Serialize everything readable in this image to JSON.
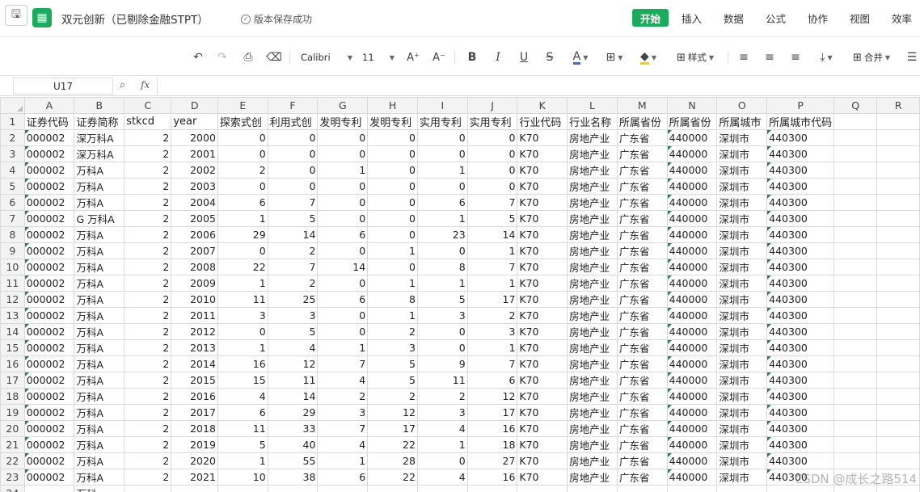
{
  "titlebar": {
    "doc_title": "双元创新（已剔除金融STPT）",
    "save_status": "版本保存成功",
    "menus": [
      "开始",
      "插入",
      "数据",
      "公式",
      "协作",
      "视图",
      "效率"
    ]
  },
  "toolbar": {
    "font_name": "Calibri",
    "font_size": "11",
    "style_label": "样式",
    "merge_label": "合并"
  },
  "formula_bar": {
    "cell_ref": "U17",
    "fx": "fx",
    "value": ""
  },
  "grid": {
    "columns": [
      "A",
      "B",
      "C",
      "D",
      "E",
      "F",
      "G",
      "H",
      "I",
      "J",
      "K",
      "L",
      "M",
      "N",
      "O",
      "P",
      "Q",
      "R"
    ],
    "header_row": [
      "证券代码",
      "证券简称",
      "stkcd",
      "year",
      "探索式创",
      "利用式创",
      "发明专利",
      "发明专利",
      "实用专利",
      "实用专利",
      "行业代码",
      "行业名称",
      "所属省份",
      "所属省份",
      "所属城市",
      "所属城市代码",
      "",
      ""
    ],
    "rows": [
      [
        "000002",
        "深万科A",
        "2",
        "2000",
        "0",
        "0",
        "0",
        "0",
        "0",
        "0",
        "K70",
        "房地产业",
        "广东省",
        "440000",
        "深圳市",
        "440300"
      ],
      [
        "000002",
        "深万科A",
        "2",
        "2001",
        "0",
        "0",
        "0",
        "0",
        "0",
        "0",
        "K70",
        "房地产业",
        "广东省",
        "440000",
        "深圳市",
        "440300"
      ],
      [
        "000002",
        "万科A",
        "2",
        "2002",
        "2",
        "0",
        "1",
        "0",
        "1",
        "0",
        "K70",
        "房地产业",
        "广东省",
        "440000",
        "深圳市",
        "440300"
      ],
      [
        "000002",
        "万科A",
        "2",
        "2003",
        "0",
        "0",
        "0",
        "0",
        "0",
        "0",
        "K70",
        "房地产业",
        "广东省",
        "440000",
        "深圳市",
        "440300"
      ],
      [
        "000002",
        "万科A",
        "2",
        "2004",
        "6",
        "7",
        "0",
        "0",
        "6",
        "7",
        "K70",
        "房地产业",
        "广东省",
        "440000",
        "深圳市",
        "440300"
      ],
      [
        "000002",
        "G 万科A",
        "2",
        "2005",
        "1",
        "5",
        "0",
        "0",
        "1",
        "5",
        "K70",
        "房地产业",
        "广东省",
        "440000",
        "深圳市",
        "440300"
      ],
      [
        "000002",
        "万科A",
        "2",
        "2006",
        "29",
        "14",
        "6",
        "0",
        "23",
        "14",
        "K70",
        "房地产业",
        "广东省",
        "440000",
        "深圳市",
        "440300"
      ],
      [
        "000002",
        "万科A",
        "2",
        "2007",
        "0",
        "2",
        "0",
        "1",
        "0",
        "1",
        "K70",
        "房地产业",
        "广东省",
        "440000",
        "深圳市",
        "440300"
      ],
      [
        "000002",
        "万科A",
        "2",
        "2008",
        "22",
        "7",
        "14",
        "0",
        "8",
        "7",
        "K70",
        "房地产业",
        "广东省",
        "440000",
        "深圳市",
        "440300"
      ],
      [
        "000002",
        "万科A",
        "2",
        "2009",
        "1",
        "2",
        "0",
        "1",
        "1",
        "1",
        "K70",
        "房地产业",
        "广东省",
        "440000",
        "深圳市",
        "440300"
      ],
      [
        "000002",
        "万科A",
        "2",
        "2010",
        "11",
        "25",
        "6",
        "8",
        "5",
        "17",
        "K70",
        "房地产业",
        "广东省",
        "440000",
        "深圳市",
        "440300"
      ],
      [
        "000002",
        "万科A",
        "2",
        "2011",
        "3",
        "3",
        "0",
        "1",
        "3",
        "2",
        "K70",
        "房地产业",
        "广东省",
        "440000",
        "深圳市",
        "440300"
      ],
      [
        "000002",
        "万科A",
        "2",
        "2012",
        "0",
        "5",
        "0",
        "2",
        "0",
        "3",
        "K70",
        "房地产业",
        "广东省",
        "440000",
        "深圳市",
        "440300"
      ],
      [
        "000002",
        "万科A",
        "2",
        "2013",
        "1",
        "4",
        "1",
        "3",
        "0",
        "1",
        "K70",
        "房地产业",
        "广东省",
        "440000",
        "深圳市",
        "440300"
      ],
      [
        "000002",
        "万科A",
        "2",
        "2014",
        "16",
        "12",
        "7",
        "5",
        "9",
        "7",
        "K70",
        "房地产业",
        "广东省",
        "440000",
        "深圳市",
        "440300"
      ],
      [
        "000002",
        "万科A",
        "2",
        "2015",
        "15",
        "11",
        "4",
        "5",
        "11",
        "6",
        "K70",
        "房地产业",
        "广东省",
        "440000",
        "深圳市",
        "440300"
      ],
      [
        "000002",
        "万科A",
        "2",
        "2016",
        "4",
        "14",
        "2",
        "2",
        "2",
        "12",
        "K70",
        "房地产业",
        "广东省",
        "440000",
        "深圳市",
        "440300"
      ],
      [
        "000002",
        "万科A",
        "2",
        "2017",
        "6",
        "29",
        "3",
        "12",
        "3",
        "17",
        "K70",
        "房地产业",
        "广东省",
        "440000",
        "深圳市",
        "440300"
      ],
      [
        "000002",
        "万科A",
        "2",
        "2018",
        "11",
        "33",
        "7",
        "17",
        "4",
        "16",
        "K70",
        "房地产业",
        "广东省",
        "440000",
        "深圳市",
        "440300"
      ],
      [
        "000002",
        "万科A",
        "2",
        "2019",
        "5",
        "40",
        "4",
        "22",
        "1",
        "18",
        "K70",
        "房地产业",
        "广东省",
        "440000",
        "深圳市",
        "440300"
      ],
      [
        "000002",
        "万科A",
        "2",
        "2020",
        "1",
        "55",
        "1",
        "28",
        "0",
        "27",
        "K70",
        "房地产业",
        "广东省",
        "440000",
        "深圳市",
        "440300"
      ],
      [
        "000002",
        "万科A",
        "2",
        "2021",
        "10",
        "38",
        "6",
        "22",
        "4",
        "16",
        "K70",
        "房地产业",
        "广东省",
        "440000",
        "深圳市",
        "440300"
      ],
      [
        "",
        "万科",
        "",
        "",
        "",
        "",
        "",
        "",
        "",
        "",
        "",
        "",
        "",
        "",
        "",
        ""
      ]
    ]
  },
  "watermark": "CSDN @成长之路514"
}
